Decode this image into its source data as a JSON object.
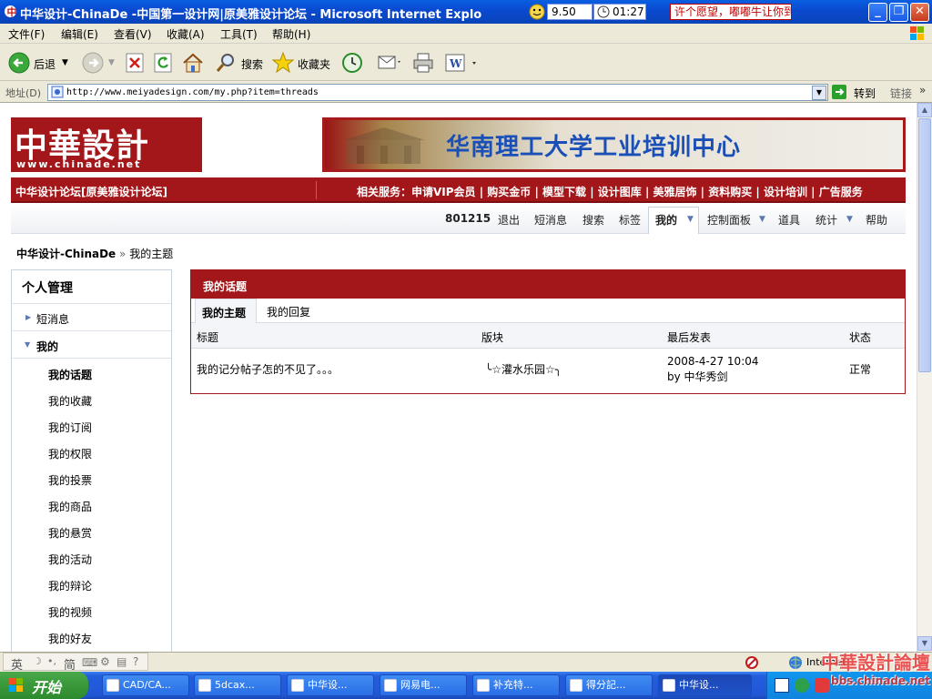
{
  "window": {
    "title": "中华设计-ChinaDe -中国第一设计网|原美雅设计论坛 - Microsoft Internet Explo",
    "clock_a": "9.50",
    "clock_b": "01:27",
    "ticker": "许个愿望，嘟嘟牛让你到",
    "min_glyph": "_",
    "max_glyph": "❐",
    "close_glyph": "✕"
  },
  "menu": [
    "文件(F)",
    "编辑(E)",
    "查看(V)",
    "收藏(A)",
    "工具(T)",
    "帮助(H)"
  ],
  "toolbar": {
    "back": "后退",
    "search": "搜索",
    "favorites": "收藏夹"
  },
  "address": {
    "label": "地址(D)",
    "url": "http://www.meiyadesign.com/my.php?item=threads",
    "go": "转到",
    "links": "链接"
  },
  "header": {
    "logo_text": "中華設計",
    "logo_url": "www.chinade.net",
    "banner_text": "华南理工大学工业培训中心",
    "forum_name": "中华设计论坛[原美雅设计论坛]",
    "services": "相关服务：申请VIP会员 | 购买金币 | 模型下载 | 设计图库 | 美雅居饰 | 资料购买 | 设计培训 | 广告服务"
  },
  "usernav": {
    "user": "801215",
    "logout": "退出",
    "messages": "短消息",
    "search": "搜索",
    "tags": "标签",
    "mine": "我的",
    "control_panel": "控制面板",
    "tools": "道具",
    "stats": "统计",
    "help": "帮助"
  },
  "breadcrumb": {
    "home": "中华设计-ChinaDe",
    "sep": "»",
    "current": "我的主题"
  },
  "sidebar": {
    "title": "个人管理",
    "messages": "短消息",
    "mine": "我的",
    "items": [
      "我的话题",
      "我的收藏",
      "我的订阅",
      "我的权限",
      "我的投票",
      "我的商品",
      "我的悬赏",
      "我的活动",
      "我的辩论",
      "我的视频",
      "我的好友"
    ]
  },
  "main": {
    "title": "我的话题",
    "tabs": [
      "我的主题",
      "我的回复"
    ],
    "columns": [
      "标题",
      "版块",
      "最后发表",
      "状态"
    ],
    "rows": [
      {
        "title": "我的记分帖子怎的不见了。。。",
        "board": "╰☆灌水乐园☆╮",
        "last_date": "2008-4-27 10:04",
        "last_by": "by 中华秀剑",
        "status": "正常"
      }
    ]
  },
  "statusbar": {
    "ime": "英",
    "ime2": "简",
    "zone": "Internet"
  },
  "taskbar": {
    "start": "开始",
    "tasks": [
      "CAD/CA...",
      "5dcax...",
      "中华设...",
      "网易电...",
      "补充特...",
      "得分記...",
      "中华设..."
    ]
  },
  "watermark": {
    "line1": "中華設計論壇",
    "line2": "bbs.chinade.net"
  }
}
